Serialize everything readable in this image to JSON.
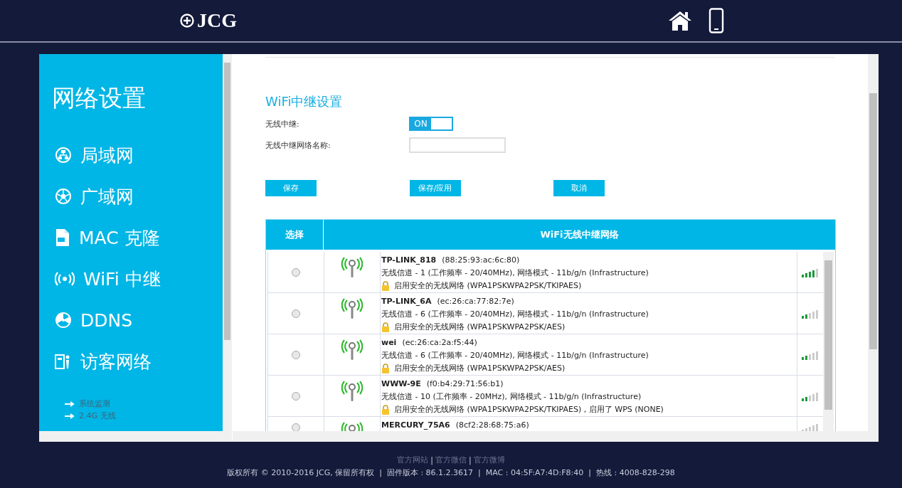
{
  "header": {
    "logo": "JCG"
  },
  "sidebar": {
    "title": "网络设置",
    "items": [
      {
        "label": "局域网",
        "kind": "lan"
      },
      {
        "label": "广域网",
        "kind": "wan"
      },
      {
        "label": "MAC 克隆",
        "kind": "doc"
      },
      {
        "label": "WiFi 中继",
        "kind": "wifi"
      },
      {
        "label": "DDNS",
        "kind": "fan"
      },
      {
        "label": "访客网络",
        "kind": "guest"
      }
    ],
    "sub_items": [
      "系统监测",
      "2.4G 无线"
    ]
  },
  "form": {
    "title": "WiFi中继设置",
    "repeater_label": "无线中继:",
    "repeater": {
      "label": "ON",
      "on": true
    },
    "ssid_label": "无线中继网络名称:",
    "buttons": [
      "保存",
      "保存/应用",
      "取消"
    ]
  },
  "table": {
    "columns": [
      "选择",
      "WiFi无线中继网络"
    ],
    "rows": [
      {
        "selected": false,
        "ssid": "TP-LINK_818",
        "mac": "(88:25:93:ac:6c:80)",
        "detail": "无线信道 - 1 (工作频率 - 20/40MHz), 网络模式 - 11b/g/n (Infrastructure)",
        "security": "启用安全的无线网络 (WPA1PSKWPA2PSK/TKIPAES)",
        "level": 0.8
      },
      {
        "selected": false,
        "ssid": "TP-LINK_6A",
        "mac": "(ec:26:ca:77:82:7e)",
        "detail": "无线信道 - 6 (工作频率 - 20/40MHz), 网络模式 - 11b/g/n (Infrastructure)",
        "security": "启用安全的无线网络 (WPA1PSKWPA2PSK/AES)",
        "level": 0.4
      },
      {
        "selected": false,
        "ssid": "wei",
        "mac": "(ec:26:ca:2a:f5:44)",
        "detail": "无线信道 - 6 (工作频率 - 20/40MHz), 网络模式 - 11b/g/n (Infrastructure)",
        "security": "启用安全的无线网络 (WPA1PSKWPA2PSK/AES)",
        "level": 0.4
      },
      {
        "selected": false,
        "ssid": "WWW-9E",
        "mac": "(f0:b4:29:71:56:b1)",
        "detail": "无线信道 - 10 (工作频率 - 20MHz), 网络模式 - 11b/g/n (Infrastructure)",
        "security": "启用安全的无线网络 (WPA1PSKWPA2PSK/TKIPAES) , 启用了 WPS (NONE)",
        "level": 0.4
      },
      {
        "selected": false,
        "ssid": "MERCURY_75A6",
        "mac": "(8cf2:28:68:75:a6)",
        "level": 0
      }
    ]
  },
  "footer": {
    "separator": "|",
    "links": [
      "官方网站",
      "官方微信",
      "官方微博"
    ],
    "info": "版权所有 © 2010-2016 JCG, 保留所有权  |  固件版本 : 86.1.2.3617  |  MAC : 04:5F:A7:4D:F8:40  |  热线 : 4008-828-298"
  }
}
